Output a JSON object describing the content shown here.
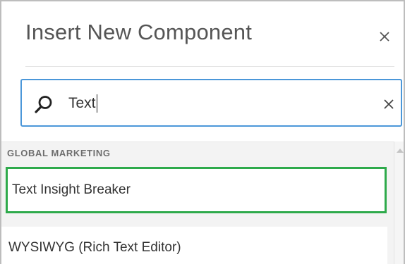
{
  "dialog": {
    "title": "Insert New Component",
    "close_icon": "close-icon"
  },
  "search": {
    "value": "Text",
    "search_icon": "search-icon",
    "clear_icon": "clear-icon"
  },
  "results": {
    "group_label": "GLOBAL MARKETING",
    "items": [
      {
        "label": "Text Insight Breaker",
        "highlight_color": "#2eaa4b"
      },
      {
        "label": "WYSIWYG (Rich Text Editor)"
      }
    ]
  },
  "colors": {
    "search_border": "#4b97d9",
    "selection_border": "#2eaa4b"
  }
}
